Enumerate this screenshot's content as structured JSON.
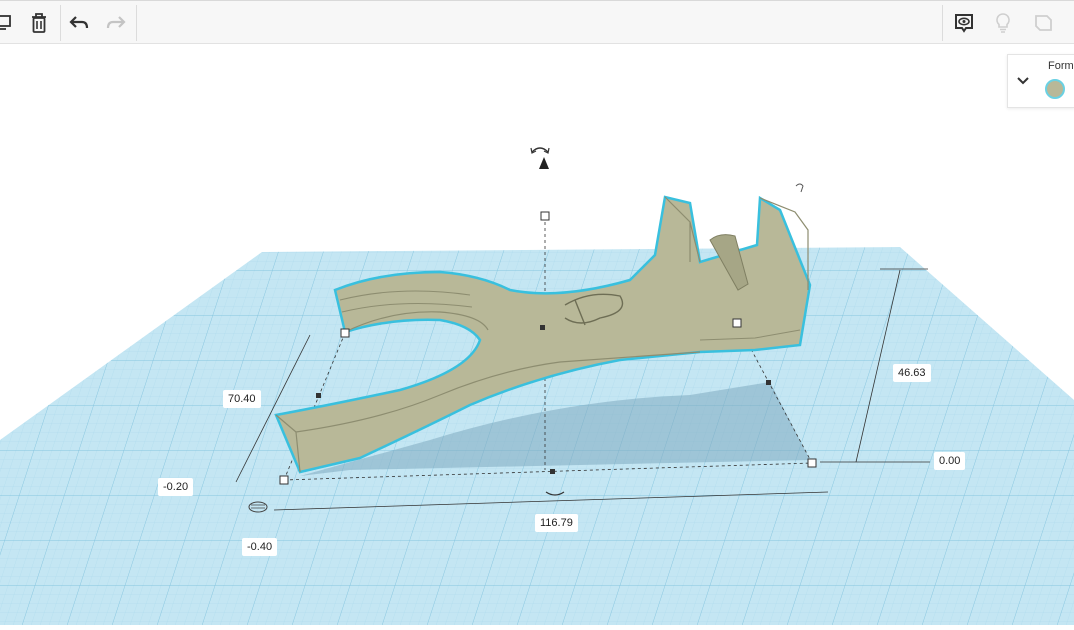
{
  "toolbar": {
    "buttons": [
      {
        "name": "copy-icon",
        "enabled": true
      },
      {
        "name": "trash-icon",
        "enabled": true
      },
      {
        "name": "undo-icon",
        "enabled": true
      },
      {
        "name": "redo-icon",
        "enabled": false
      }
    ],
    "right_buttons": [
      {
        "name": "show-hide-icon",
        "enabled": true
      },
      {
        "name": "lightbulb-icon",
        "enabled": false
      },
      {
        "name": "note-icon",
        "enabled": false
      }
    ]
  },
  "shape_panel": {
    "title": "Form",
    "color": "#b8b898",
    "outline_color": "#6ad1e3"
  },
  "dimensions": {
    "width": "116.79",
    "depth": "70.40",
    "height": "46.63",
    "elevation": "0.00",
    "x_offset": "-0.20",
    "y_offset": "-0.40"
  },
  "colors": {
    "grid": "#bfe3f1",
    "grid_line": "#8fcbe2",
    "shape_fill": "#b8b898",
    "shape_dark": "#8d8d70",
    "selection": "#39c0de"
  }
}
